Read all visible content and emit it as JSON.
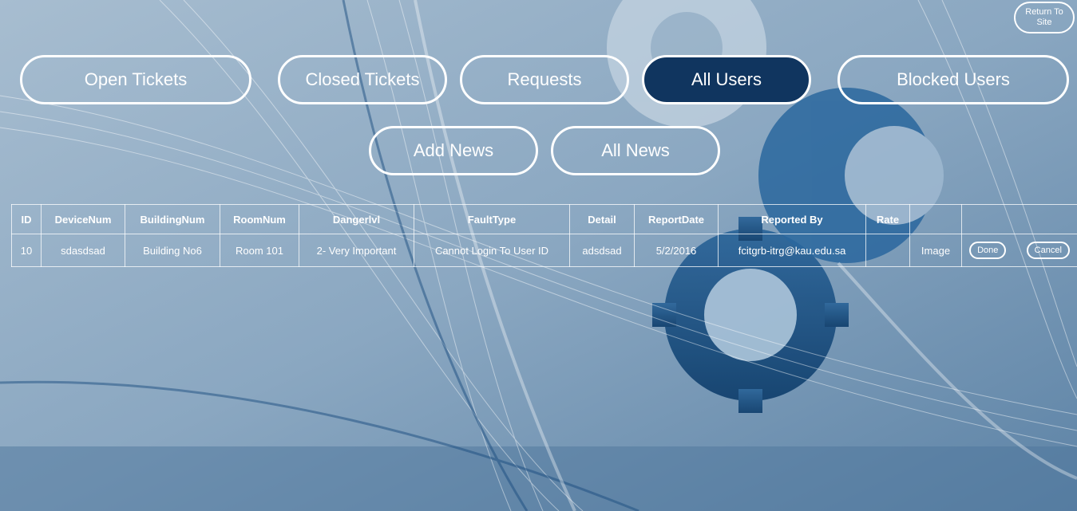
{
  "return_link": "Return To Site",
  "nav_row1": [
    {
      "label": "Open Tickets",
      "active": false
    },
    {
      "label": "Closed Tickets",
      "active": false
    },
    {
      "label": "Requests",
      "active": false
    },
    {
      "label": "All Users",
      "active": true
    },
    {
      "label": "Blocked Users",
      "active": false
    }
  ],
  "nav_row2": [
    {
      "label": "Add News"
    },
    {
      "label": "All News"
    }
  ],
  "table": {
    "headers": [
      "ID",
      "DeviceNum",
      "BuildingNum",
      "RoomNum",
      "Dangerlvl",
      "FaultType",
      "Detail",
      "ReportDate",
      "Reported By",
      "Rate",
      "",
      ""
    ],
    "rows": [
      {
        "id": "10",
        "device": "sdasdsad",
        "building": "Building No6",
        "room": "Room 101",
        "danger": "2- Very Important",
        "fault": "Cannot Login To User ID",
        "detail": "adsdsad",
        "date": "5/2/2016",
        "reporter": "fcitgrb-itrg@kau.edu.sa",
        "rate": "",
        "image": "Image",
        "done": "Done",
        "cancel": "Cancel"
      }
    ]
  },
  "colors": {
    "active_button": "#10355f",
    "text": "#ffffff",
    "background": "#7d9bb7"
  }
}
